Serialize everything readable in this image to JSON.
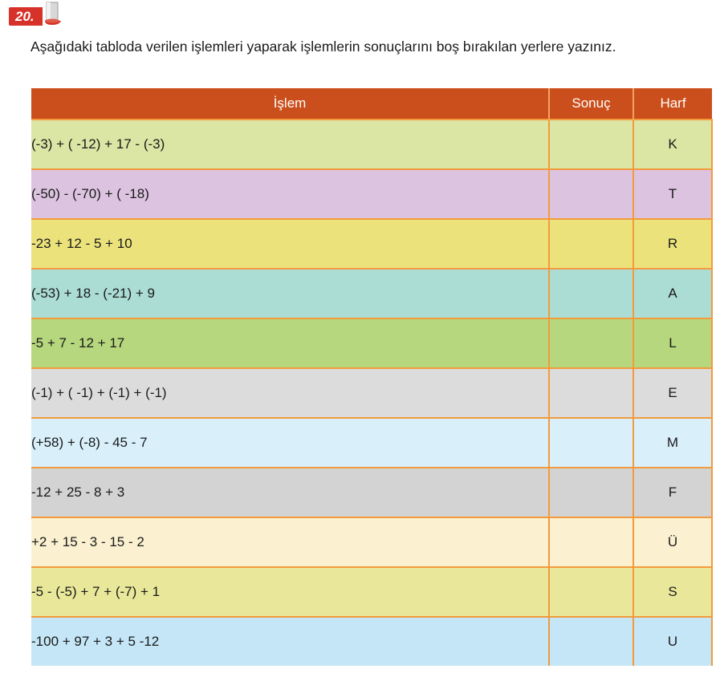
{
  "question": {
    "number": "20.",
    "prompt": "Aşağıdaki tabloda verilen işlemleri yaparak işlemlerin sonuçlarını boş bırakılan yerlere yazınız."
  },
  "table": {
    "headers": {
      "operation": "İşlem",
      "result": "Sonuç",
      "letter": "Harf"
    },
    "rows": [
      {
        "operation": "(-3) + ( -12) + 17 - (-3)",
        "result": "",
        "letter": "K",
        "color": "#dbe5a4"
      },
      {
        "operation": "(-50) - (-70) + ( -18)",
        "result": "",
        "letter": "T",
        "color": "#dcc3e0"
      },
      {
        "operation": "-23 + 12 - 5 + 10",
        "result": "",
        "letter": "R",
        "color": "#ebe27c"
      },
      {
        "operation": "(-53) + 18 - (-21) + 9",
        "result": "",
        "letter": "A",
        "color": "#abddd4"
      },
      {
        "operation": "-5 + 7 - 12 + 17",
        "result": "",
        "letter": "L",
        "color": "#b6d77d"
      },
      {
        "operation": "(-1) + ( -1) + (-1) + (-1)",
        "result": "",
        "letter": "E",
        "color": "#dcdcdc"
      },
      {
        "operation": "(+58) + (-8) - 45 - 7",
        "result": "",
        "letter": "M",
        "color": "#d9f0fb"
      },
      {
        "operation": "-12 + 25 - 8 + 3",
        "result": "",
        "letter": "F",
        "color": "#d3d3d3"
      },
      {
        "operation": "+2 + 15 - 3 - 15 - 2",
        "result": "",
        "letter": "Ü",
        "color": "#fbf0d0"
      },
      {
        "operation": "-5 - (-5) + 7 + (-7) + 1",
        "result": "",
        "letter": "S",
        "color": "#e9e89a"
      },
      {
        "operation": "-100 + 97 + 3 + 5 -12",
        "result": "",
        "letter": "U",
        "color": "#c4e6f6"
      }
    ]
  },
  "colors": {
    "header_bg": "#cb4f1c",
    "grid_line": "#f39a3c",
    "badge_bg": "#d6322a"
  }
}
